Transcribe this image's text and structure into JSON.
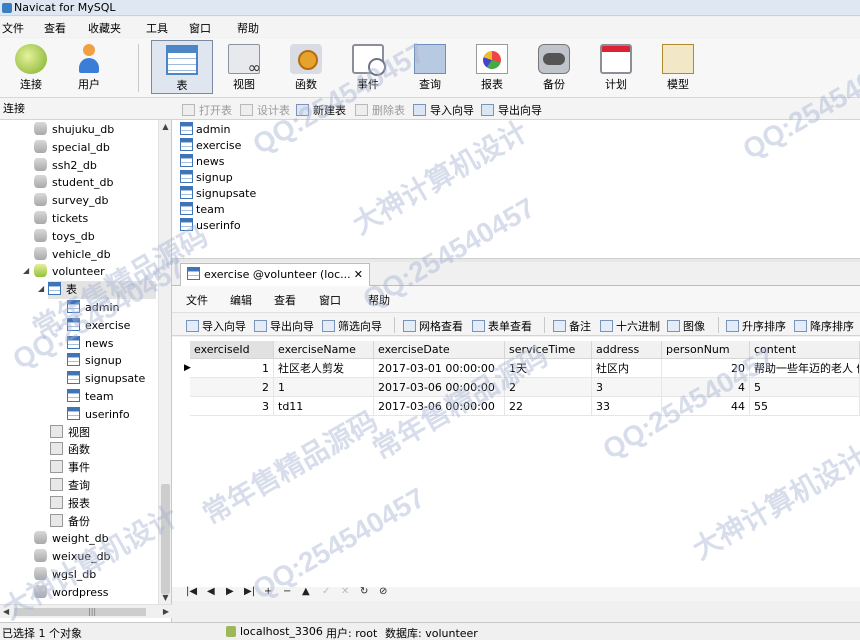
{
  "window": {
    "title": "Navicat for MySQL"
  },
  "menu": [
    "文件",
    "查看",
    "收藏夹",
    "工具",
    "窗口",
    "帮助"
  ],
  "toolbar": [
    {
      "label": "连接",
      "icon": "connection-icon"
    },
    {
      "label": "用户",
      "icon": "user-icon"
    },
    {
      "label": "表",
      "icon": "table-icon",
      "active": true
    },
    {
      "label": "视图",
      "icon": "view-icon"
    },
    {
      "label": "函数",
      "icon": "function-icon"
    },
    {
      "label": "事件",
      "icon": "event-icon"
    },
    {
      "label": "查询",
      "icon": "query-icon"
    },
    {
      "label": "报表",
      "icon": "report-icon"
    },
    {
      "label": "备份",
      "icon": "backup-icon"
    },
    {
      "label": "计划",
      "icon": "schedule-icon"
    },
    {
      "label": "模型",
      "icon": "model-icon"
    }
  ],
  "sidebar": {
    "header": "连接",
    "databases": [
      "shujuku_db",
      "special_db",
      "ssh2_db",
      "student_db",
      "survey_db",
      "tickets",
      "toys_db",
      "vehicle_db"
    ],
    "open_db": "volunteer",
    "tables_label": "表",
    "tables": [
      "admin",
      "exercise",
      "news",
      "signup",
      "signupsate",
      "team",
      "userinfo"
    ],
    "objects": [
      {
        "label": "视图",
        "icon": "view-icon"
      },
      {
        "label": "函数",
        "icon": "function-icon"
      },
      {
        "label": "事件",
        "icon": "event-icon"
      },
      {
        "label": "查询",
        "icon": "query-icon"
      },
      {
        "label": "报表",
        "icon": "report-icon"
      },
      {
        "label": "备份",
        "icon": "backup-icon"
      }
    ],
    "more_databases": [
      "weight_db",
      "weixue_db",
      "wgsl_db",
      "wordpress"
    ]
  },
  "object_toolbar": [
    {
      "label": "打开表",
      "enabled": false
    },
    {
      "label": "设计表",
      "enabled": false
    },
    {
      "label": "新建表",
      "enabled": true
    },
    {
      "label": "删除表",
      "enabled": false
    },
    {
      "label": "导入向导",
      "enabled": true
    },
    {
      "label": "导出向导",
      "enabled": true
    }
  ],
  "object_list": [
    "admin",
    "exercise",
    "news",
    "signup",
    "signupsate",
    "team",
    "userinfo"
  ],
  "tab": {
    "title": "exercise @volunteer (loc...",
    "close": "✕"
  },
  "doc_menu": [
    "文件",
    "编辑",
    "查看",
    "窗口",
    "帮助"
  ],
  "grid_toolbar": [
    "导入向导",
    "导出向导",
    "筛选向导",
    "网格查看",
    "表单查看",
    "备注",
    "十六进制",
    "图像",
    "升序排序",
    "降序排序"
  ],
  "grid": {
    "columns": [
      "exerciseId",
      "exerciseName",
      "exerciseDate",
      "serviceTime",
      "address",
      "personNum",
      "content"
    ],
    "rows": [
      [
        "1",
        "社区老人剪发",
        "2017-03-01 00:00:00",
        "1天",
        "社区内",
        "20",
        "帮助一些年迈的老人 修"
      ],
      [
        "2",
        "1",
        "2017-03-06 00:00:00",
        "2",
        "3",
        "4",
        "5"
      ],
      [
        "3",
        "td11",
        "2017-03-06 00:00:00",
        "22",
        "33",
        "44",
        "55"
      ]
    ]
  },
  "nav_buttons": [
    "|◀",
    "◀",
    "▶",
    "▶|",
    "+",
    "−",
    "▲",
    "✓",
    "✕",
    "↻",
    "⊘"
  ],
  "status": {
    "selection": "已选择 1 个对象",
    "connection": "localhost_3306",
    "user": "用户: root",
    "database": "数据库: volunteer"
  },
  "watermark": [
    "QQ:254540457",
    "大神计算机设计",
    "常年售精品源码"
  ]
}
